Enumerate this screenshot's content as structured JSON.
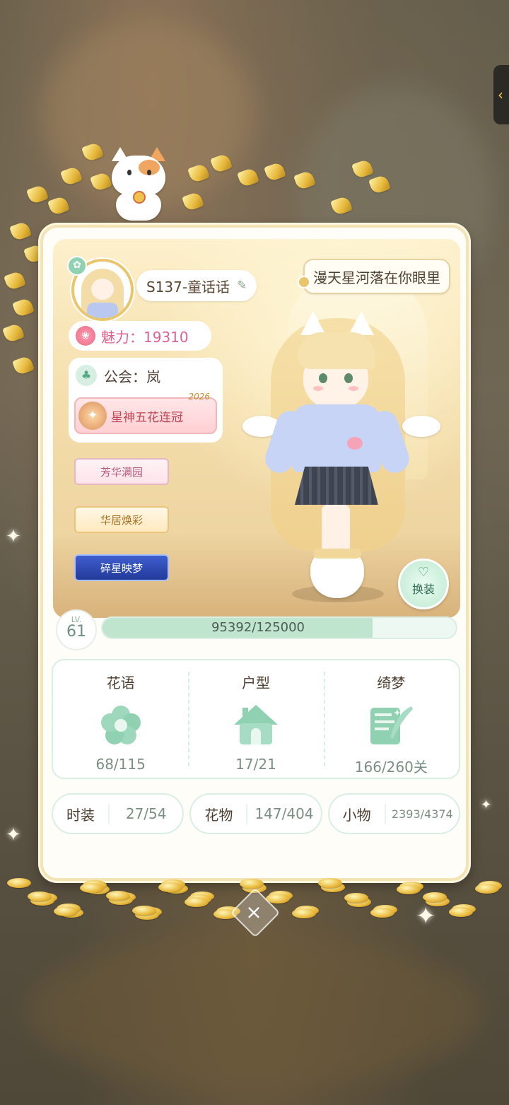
{
  "header": {
    "side_tab_icon": "chevron-left-icon",
    "side_tab_glyph": "‹"
  },
  "profile": {
    "name": "S137-童话话",
    "signature": "漫天星河落在你眼里",
    "charm": "魅力：19310",
    "guild": "公会：岚",
    "guild_badge": "星神五花连冠",
    "guild_badge_year": "2026",
    "titles": [
      "芳华满园",
      "华居焕彩",
      "碎星映梦"
    ]
  },
  "change_outfit_label": "换装",
  "level": {
    "lv_label": "LV.",
    "value": "61",
    "exp_text": "95392/125000",
    "exp_fraction": 0.7631
  },
  "stats": [
    {
      "title": "花语",
      "value": "68/115",
      "icon": "flower-icon"
    },
    {
      "title": "户型",
      "value": "17/21",
      "icon": "house-icon"
    },
    {
      "title": "绮梦",
      "value": "166/260关",
      "icon": "quill-book-icon"
    }
  ],
  "collections": [
    {
      "label": "时装",
      "value": "27/54"
    },
    {
      "label": "花物",
      "value": "147/404"
    },
    {
      "label": "小物",
      "value": "2393/4374"
    }
  ],
  "colors": {
    "accent_mint": "#bfe5cf",
    "charm_pink": "#e0628a",
    "gold": "#e9c56d"
  }
}
